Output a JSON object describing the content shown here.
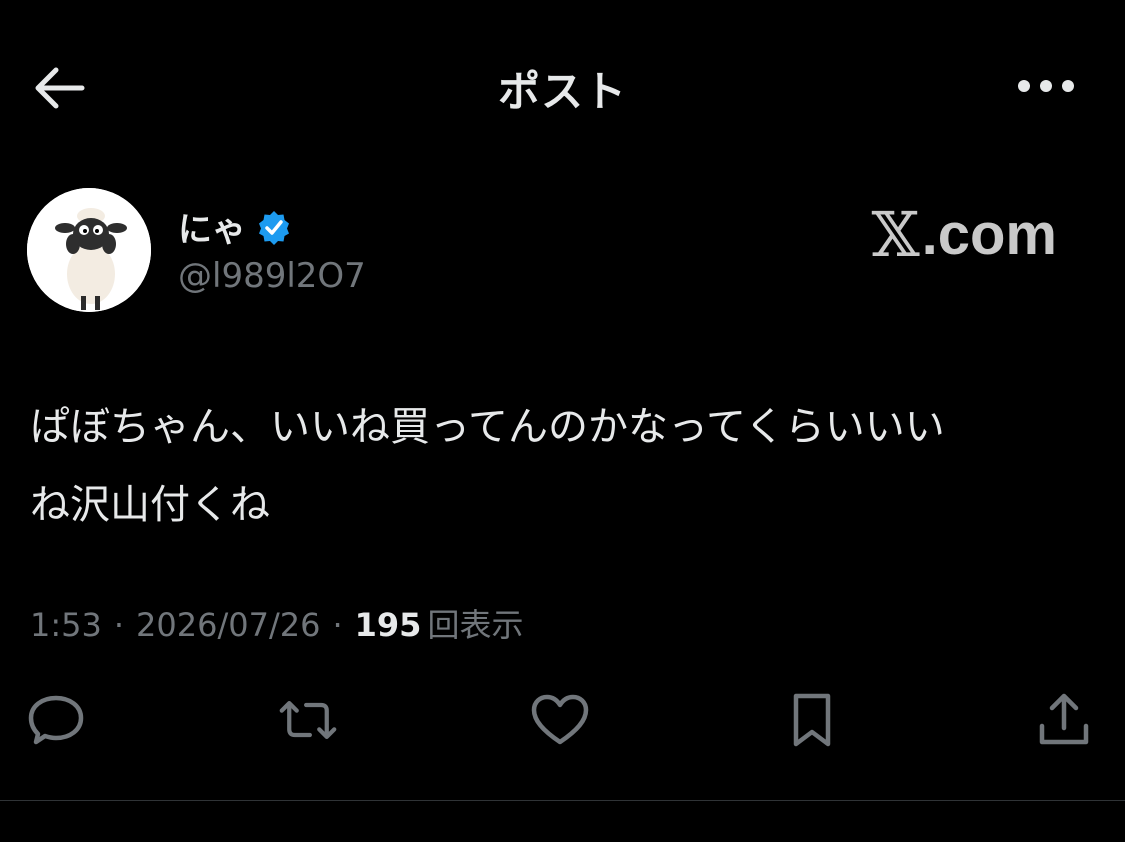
{
  "header": {
    "title": "ポスト",
    "back_icon": "arrow-left-icon",
    "more_icon": "more-horizontal-icon"
  },
  "author": {
    "display_name": "にゃ",
    "handle": "@l989l2O7",
    "verified": true,
    "verified_color": "#1d9bf0"
  },
  "watermark": {
    "x_glyph": "𝕏",
    "text": ".com"
  },
  "post": {
    "text_line1": "ぱぼちゃん、いいね買ってんのかなってくらいいい",
    "text_line2": "ね沢山付くね"
  },
  "meta": {
    "time": "1:53",
    "date": "2026/07/26",
    "separator": "·",
    "views_count": "195",
    "views_label": "回表示"
  },
  "actions": [
    {
      "name": "reply",
      "icon": "reply-icon"
    },
    {
      "name": "repost",
      "icon": "repost-icon"
    },
    {
      "name": "like",
      "icon": "heart-icon"
    },
    {
      "name": "bookmark",
      "icon": "bookmark-icon"
    },
    {
      "name": "share",
      "icon": "share-icon"
    }
  ],
  "colors": {
    "background": "#000000",
    "text_primary": "#e7e9ea",
    "text_secondary": "#71767b",
    "divider": "#2f3336"
  }
}
